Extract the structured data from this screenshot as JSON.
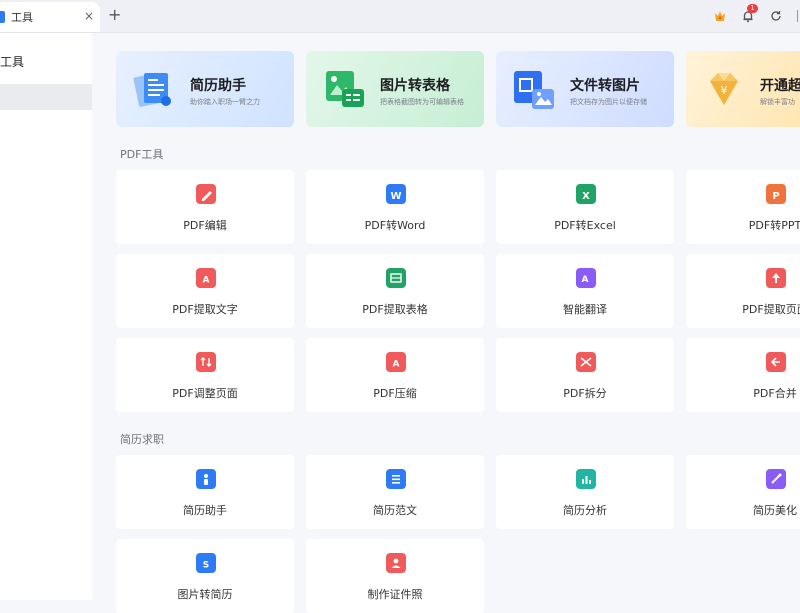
{
  "tab": {
    "label": "工具",
    "close": "×",
    "new": "+"
  },
  "notification_count": "1",
  "sidebar": {
    "title": "工具"
  },
  "features": [
    {
      "title": "简历助手",
      "subtitle": "助你踏入职场一臂之力"
    },
    {
      "title": "图片转表格",
      "subtitle": "把表格截图转为可编辑表格"
    },
    {
      "title": "文件转图片",
      "subtitle": "把文档存为图片以便存储"
    },
    {
      "title": "开通超",
      "subtitle": "解锁丰富功"
    }
  ],
  "sections": {
    "pdf": {
      "title": "PDF工具",
      "items": [
        {
          "label": "PDF编辑",
          "icon": "pdf-edit-icon",
          "color": "#f05a5a"
        },
        {
          "label": "PDF转Word",
          "icon": "word-icon",
          "color": "#2f7bf5"
        },
        {
          "label": "PDF转Excel",
          "icon": "excel-icon",
          "color": "#21a366"
        },
        {
          "label": "PDF转PPT",
          "icon": "ppt-icon",
          "color": "#f0733c"
        },
        {
          "label": "PDF提取文字",
          "icon": "extract-text-icon",
          "color": "#f05a5a"
        },
        {
          "label": "PDF提取表格",
          "icon": "extract-table-icon",
          "color": "#21a366"
        },
        {
          "label": "智能翻译",
          "icon": "translate-icon",
          "color": "#8a5cf5"
        },
        {
          "label": "PDF提取页面",
          "icon": "extract-page-icon",
          "color": "#f05a5a"
        },
        {
          "label": "PDF调整页面",
          "icon": "adjust-page-icon",
          "color": "#f05a5a"
        },
        {
          "label": "PDF压缩",
          "icon": "compress-icon",
          "color": "#f05a5a"
        },
        {
          "label": "PDF拆分",
          "icon": "split-icon",
          "color": "#f05a5a"
        },
        {
          "label": "PDF合并",
          "icon": "merge-icon",
          "color": "#f05a5a"
        }
      ]
    },
    "resume": {
      "title": "简历求职",
      "items": [
        {
          "label": "简历助手",
          "icon": "resume-assistant-icon",
          "color": "#2f7bf5"
        },
        {
          "label": "简历范文",
          "icon": "resume-sample-icon",
          "color": "#2f7bf5"
        },
        {
          "label": "简历分析",
          "icon": "resume-analysis-icon",
          "color": "#23b5a3"
        },
        {
          "label": "简历美化",
          "icon": "resume-beautify-icon",
          "color": "#8a5cf5"
        },
        {
          "label": "图片转简历",
          "icon": "image-to-resume-icon",
          "color": "#2f7bf5"
        },
        {
          "label": "制作证件照",
          "icon": "id-photo-icon",
          "color": "#f05a5a"
        }
      ]
    }
  }
}
